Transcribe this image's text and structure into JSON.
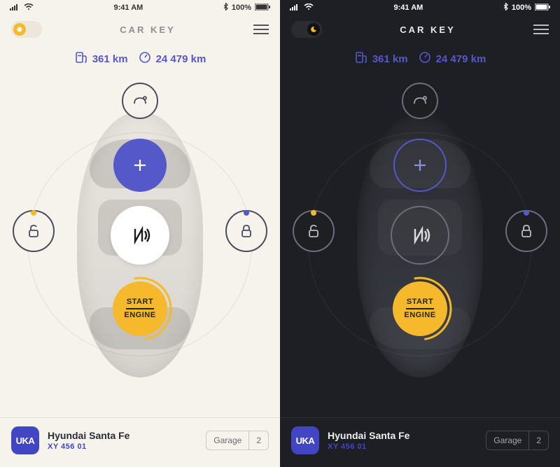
{
  "status": {
    "time": "9:41 AM",
    "battery": "100%"
  },
  "header": {
    "title": "CAR KEY"
  },
  "stats": {
    "range": "361 km",
    "odometer": "24 479 km"
  },
  "engine": {
    "line1": "START",
    "line2": "ENGINE"
  },
  "footer": {
    "badge": "UKA",
    "car_name": "Hyundai Santa Fe",
    "plate": "XY 456 01",
    "garage_label": "Garage",
    "garage_count": "2"
  }
}
